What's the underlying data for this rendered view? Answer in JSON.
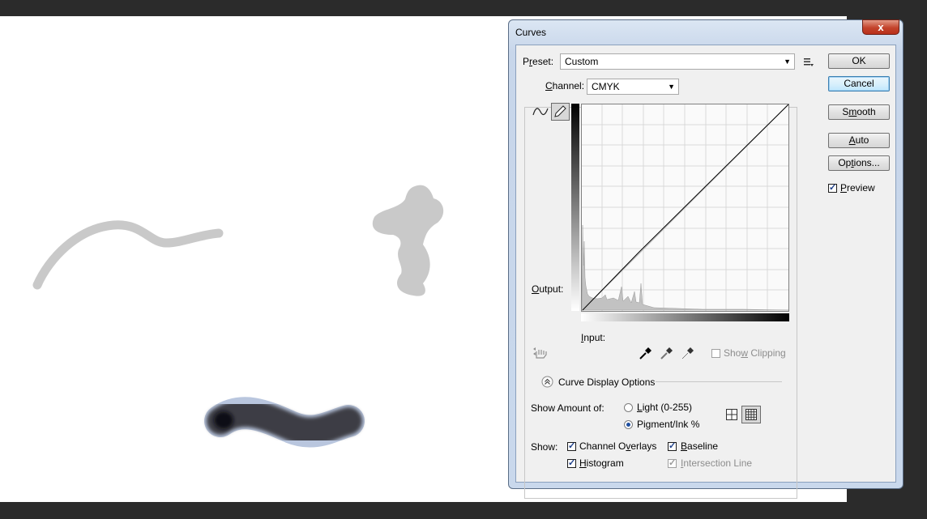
{
  "dialog": {
    "title": "Curves",
    "close_glyph": "x",
    "preset": {
      "prefix": "P",
      "accel": "r",
      "suffix": "eset:",
      "value": "Custom"
    },
    "channel": {
      "accel": "C",
      "rest": "hannel:",
      "value": "CMYK"
    },
    "output_label": {
      "accel": "O",
      "rest": "utput:"
    },
    "input_label": {
      "accel": "I",
      "rest": "nput:"
    },
    "show_clipping": {
      "prefix": "Sho",
      "accel": "w",
      "suffix": " Clipping",
      "checked": false,
      "enabled": false
    },
    "curve_display_options": "Curve Display Options",
    "show_amount_label": "Show Amount of:",
    "light_option": {
      "accel": "L",
      "rest": "ight  (0-255)",
      "selected": false
    },
    "pigment_option": {
      "prefix": "Pi",
      "accel": "g",
      "suffix": "ment/Ink %",
      "selected": true
    },
    "show_label": "Show:",
    "channel_overlays": {
      "prefix": "Channel O",
      "accel": "v",
      "suffix": "erlays",
      "checked": true
    },
    "baseline": {
      "accel": "B",
      "rest": "aseline",
      "checked": true
    },
    "histogram": {
      "accel": "H",
      "rest": "istogram",
      "checked": true
    },
    "intersection_line": {
      "accel": "I",
      "rest": "ntersection Line",
      "checked": true,
      "enabled": false
    },
    "buttons": {
      "ok": "OK",
      "cancel": "Cancel",
      "smooth": {
        "prefix": "S",
        "accel": "m",
        "suffix": "ooth"
      },
      "auto": {
        "accel": "A",
        "rest": "uto"
      },
      "options": {
        "prefix": "Op",
        "accel": "t",
        "suffix": "ions..."
      }
    },
    "preview": {
      "accel": "P",
      "rest": "review",
      "checked": true
    },
    "icons": {
      "preset_menu": "preset-options-menu-icon",
      "curve_point_tool": "curve-point-tool-icon",
      "pencil_tool": "pencil-draw-tool-icon",
      "on_image_adjust": "on-image-adjustment-hand-icon",
      "black_point": "black-point-eyedropper-icon",
      "gray_point": "gray-point-eyedropper-icon",
      "white_point": "white-point-eyedropper-icon",
      "simple_grid": "simple-grid-icon",
      "detailed_grid": "detailed-grid-icon",
      "collapse": "collapse-chevron-icon"
    }
  },
  "colors": {
    "canvas": "#ffffff",
    "workspace": "#2b2b2b",
    "stroke_light": "#c9c9c9",
    "stroke_dark": "#3c3c44"
  }
}
